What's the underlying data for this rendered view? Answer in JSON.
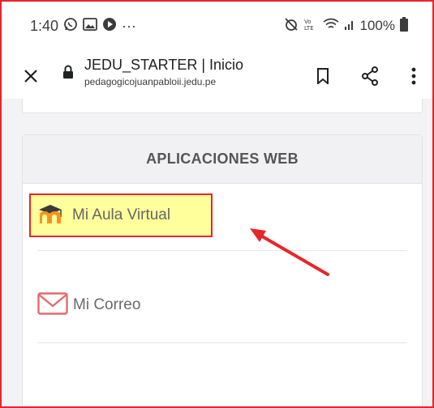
{
  "status_bar": {
    "time": "1:40",
    "more_indicator": "···",
    "battery": "100%"
  },
  "toolbar": {
    "title": "JEDU_STARTER | Inicio",
    "url": "pedagogicojuanpabloii.jedu.pe"
  },
  "apps": {
    "header": "APLICACIONES WEB",
    "items": [
      {
        "label": "Mi Aula Virtual",
        "icon": "moodle-icon"
      },
      {
        "label": "Mi Correo",
        "icon": "envelope-icon"
      }
    ]
  },
  "colors": {
    "highlight_border": "#e8262a",
    "highlight_fill": "#ffff9c",
    "moodle_orange": "#f7931e",
    "envelope_red": "#e36b6b"
  }
}
